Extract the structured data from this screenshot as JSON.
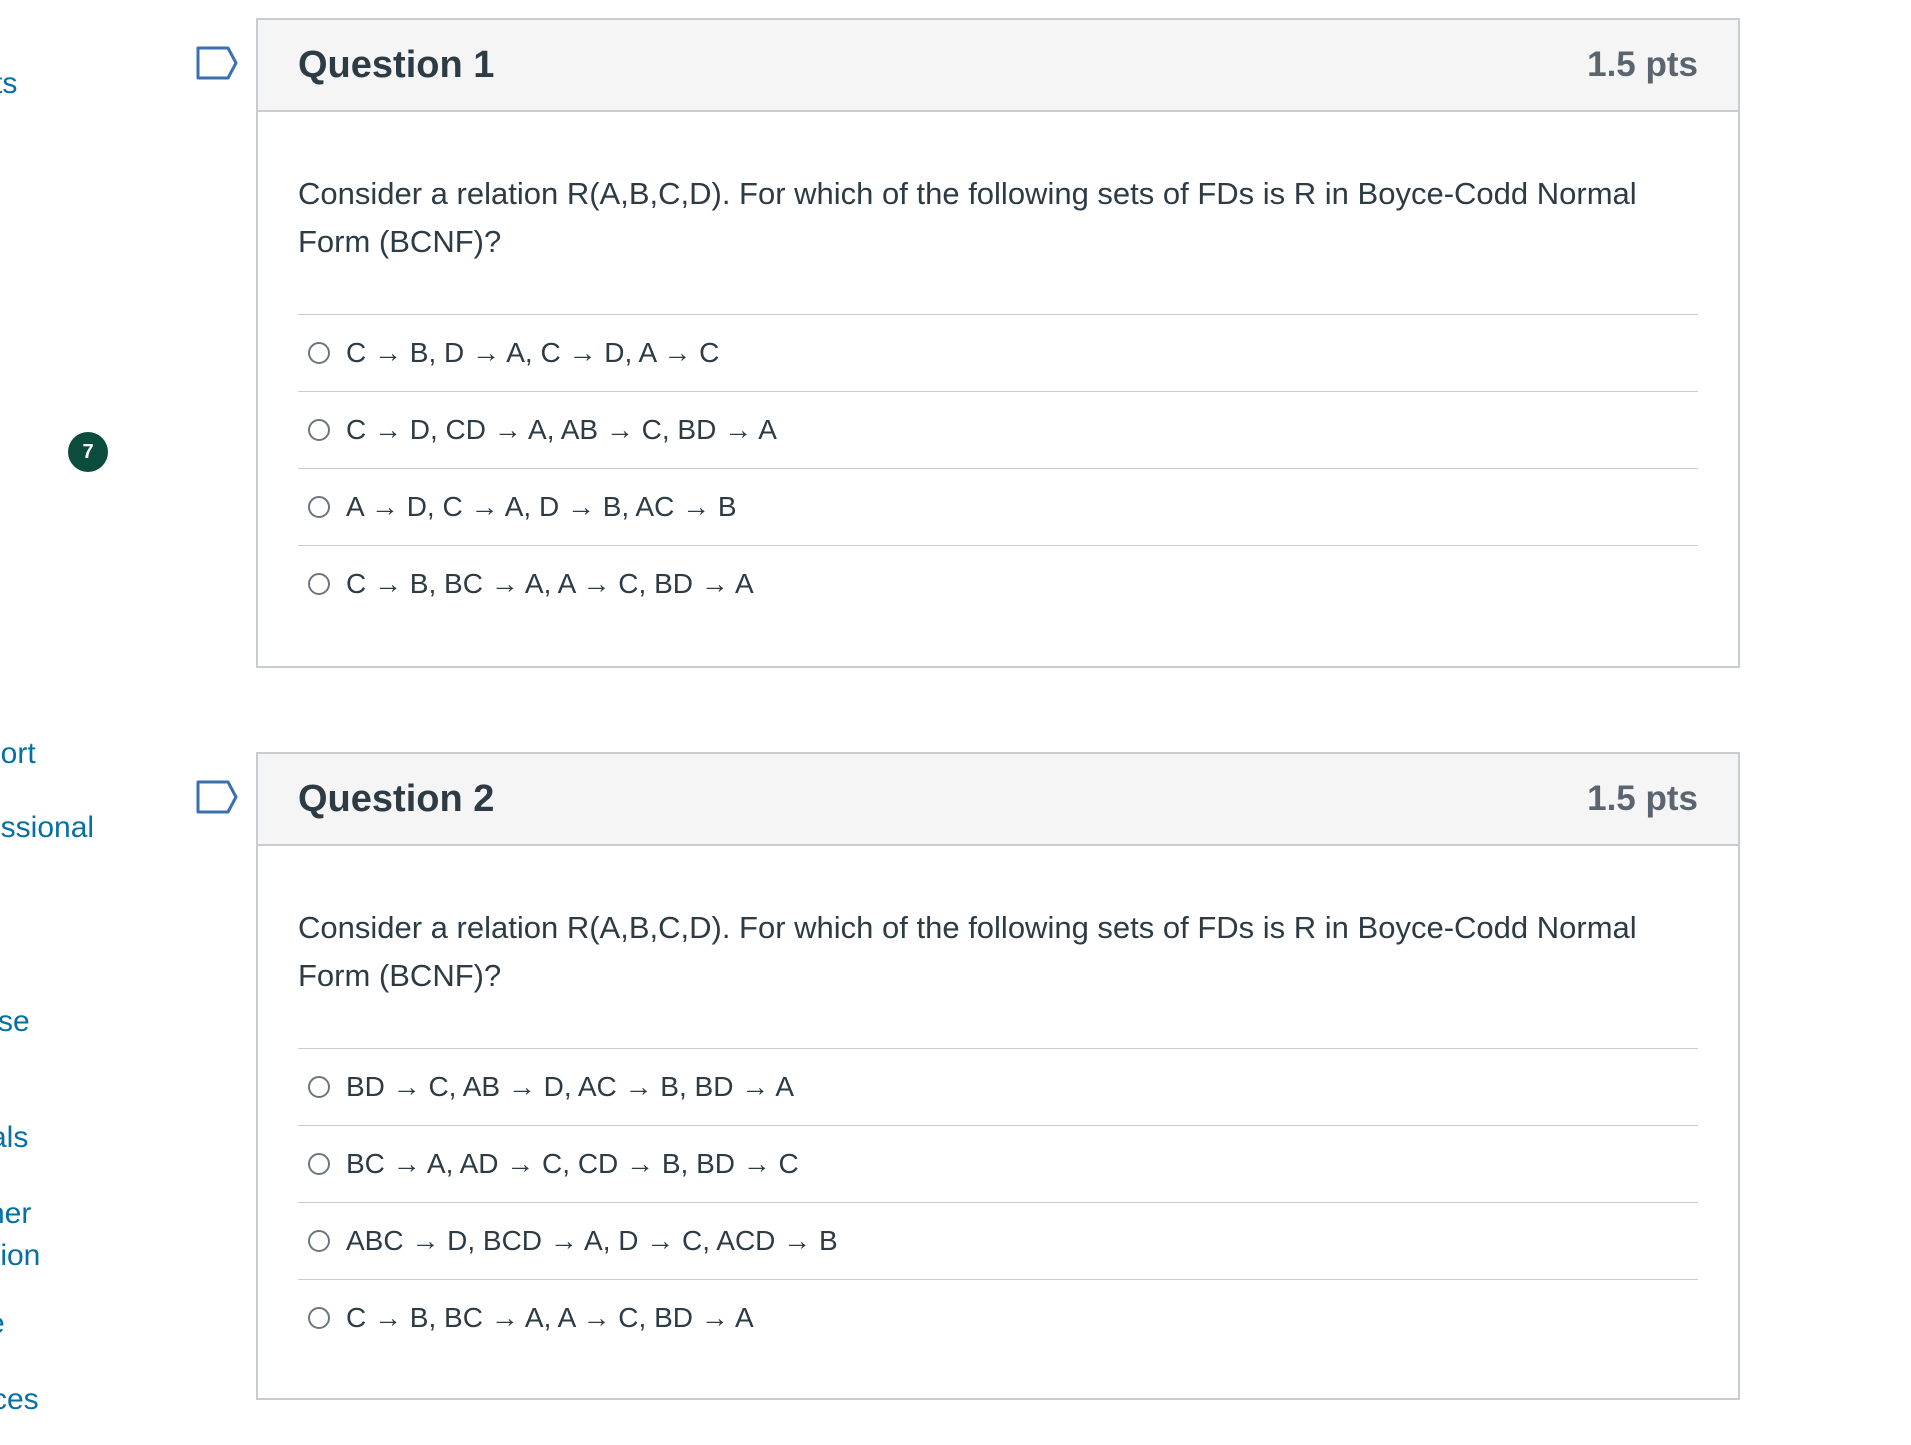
{
  "nav": {
    "items": [
      {
        "label": "ts"
      },
      {
        "label": "port"
      },
      {
        "label": "essional"
      },
      {
        "label": "se"
      },
      {
        "label": "als"
      },
      {
        "label": "her"
      },
      {
        "label": "tion"
      },
      {
        "label": "e"
      },
      {
        "label": "ces"
      }
    ],
    "badge": "7"
  },
  "questions": [
    {
      "title": "Question 1",
      "points": "1.5 pts",
      "text": "Consider a relation R(A,B,C,D). For which of the following sets of FDs is R in Boyce-Codd Normal Form (BCNF)?",
      "answers": [
        "C → B, D → A, C → D, A → C",
        "C → D, CD → A, AB → C, BD → A",
        "A → D, C → A, D → B, AC → B",
        "C → B, BC → A, A → C, BD → A"
      ]
    },
    {
      "title": "Question 2",
      "points": "1.5 pts",
      "text": "Consider a relation R(A,B,C,D). For which of the following sets of FDs is R in Boyce-Codd Normal Form (BCNF)?",
      "answers": [
        "BD → C, AB → D, AC → B, BD → A",
        "BC → A, AD → C, CD → B, BD → C",
        "ABC → D, BCD → A, D → C, ACD → B",
        "C → B, BC → A, A → C, BD → A"
      ]
    }
  ]
}
